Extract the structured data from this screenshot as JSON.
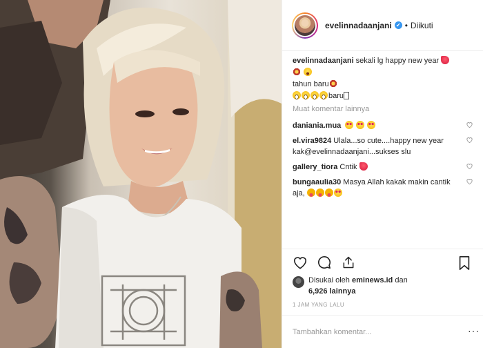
{
  "post": {
    "username": "evelinnadaanjani",
    "verified_mark": "✔",
    "separator": "•",
    "follow_status": "Diikuti"
  },
  "caption": {
    "username": "evelinnadaanjani",
    "line1": "sekali lg happy new year",
    "line2": "tahun baru",
    "line3": "baru"
  },
  "load_more": "Muat komentar lainnya",
  "comments": [
    {
      "username": "daniania.mua",
      "text": ""
    },
    {
      "username": "el.vira9824",
      "text": "Ulala...so cute....happy new year kak@evelinnadaanjani...sukses slu"
    },
    {
      "username": "gallery_tiora",
      "text": "Cntik"
    },
    {
      "username": "bungaaulia30",
      "text": "Masya Allah kakak makin cantik aja,"
    }
  ],
  "likes": {
    "prefix": "Disukai oleh",
    "liker": "eminews.id",
    "and": "dan",
    "count": "6,926 lainnya"
  },
  "timestamp": "1 JAM YANG LALU",
  "add_comment": {
    "placeholder": "Tambahkan komentar..."
  },
  "icons": {
    "like": "heart-outline-icon",
    "comment": "speech-bubble-icon",
    "share": "share-icon",
    "save": "bookmark-icon",
    "comment_like": "small-heart-icon"
  },
  "colors": {
    "verified": "#3897f0",
    "text": "#262626",
    "muted": "#999999",
    "border": "#efefef"
  }
}
